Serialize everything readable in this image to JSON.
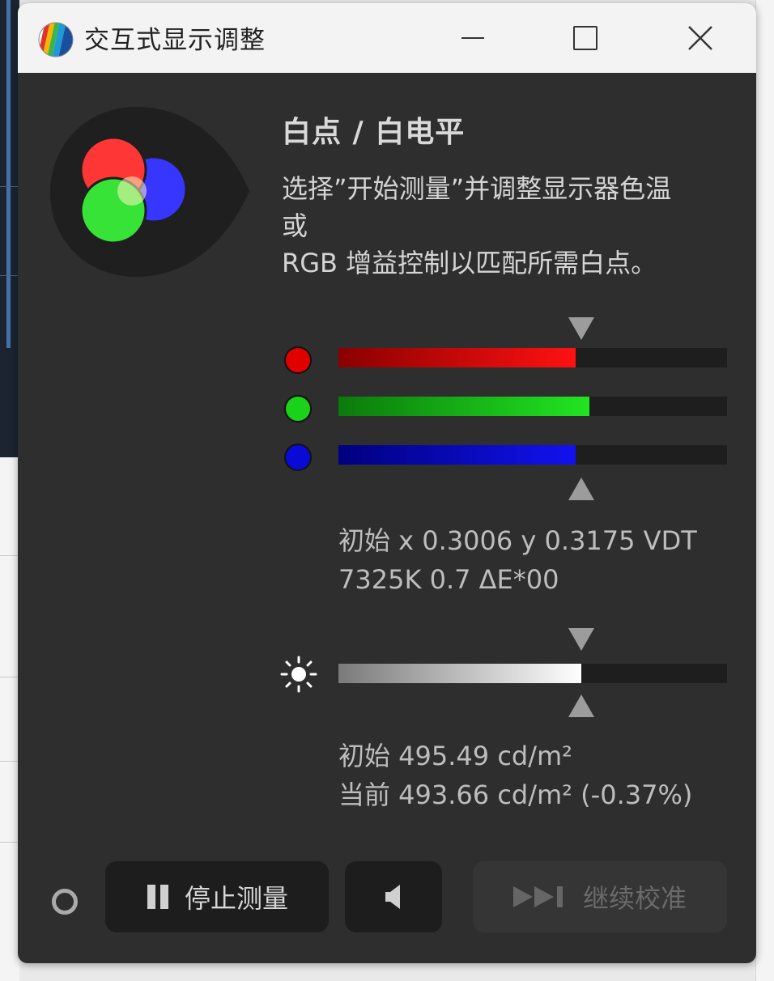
{
  "window": {
    "title": "交互式显示调整"
  },
  "panel": {
    "heading": "白点 / 白电平",
    "description_lines": [
      "选择”开始测量”并调整显示器色温",
      "或",
      "RGB 增益控制以匹配所需白点。"
    ]
  },
  "rgb_gain": {
    "red": {
      "level": 0.61,
      "color": "#e00000"
    },
    "green": {
      "level": 0.645,
      "color": "#19d219"
    },
    "blue": {
      "level": 0.61,
      "color": "#0a0ad6"
    },
    "target_level": 0.625
  },
  "white_point_readout": {
    "line1": "初始 x 0.3006 y 0.3175 VDT",
    "line2": "7325K 0.7 ΔE*00"
  },
  "brightness": {
    "level": 0.625,
    "target_level": 0.625,
    "icon": "sun-icon"
  },
  "luminance_readout": {
    "line1": "初始 495.49 cd/m²",
    "line2": "当前 493.66 cd/m² (-0.37%)"
  },
  "buttons": {
    "stop": {
      "label": "停止测量",
      "icon": "pause-icon"
    },
    "sound": {
      "icon": "speaker-icon"
    },
    "continue": {
      "label": "继续校准",
      "icon": "skip-forward-icon",
      "enabled": false
    }
  },
  "colors": {
    "panel_bg": "#2e2e2e",
    "titlebar_bg": "#f3f3f3",
    "track_bg": "#1e1e1e",
    "indicator": "#9c9c9c"
  }
}
